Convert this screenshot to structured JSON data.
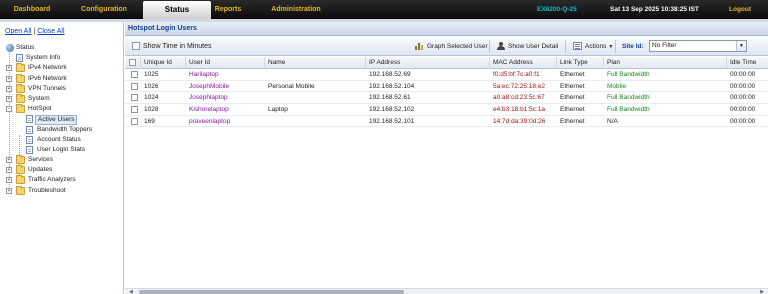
{
  "topnav": {
    "items": [
      {
        "label": "Dashboard"
      },
      {
        "label": "Configuration"
      },
      {
        "label": "Status"
      },
      {
        "label": "Reports"
      },
      {
        "label": "Administration"
      }
    ],
    "device": "EX6200-Q-25",
    "datetime": "Sat 13 Sep 2025 10:38:25 IST",
    "logout": "Logout"
  },
  "sidebar": {
    "open_all": "Open All",
    "separator": "|",
    "close_all": "Close All",
    "tree": [
      {
        "label": "Status"
      },
      {
        "label": "System Info"
      },
      {
        "label": "IPv4 Network"
      },
      {
        "label": "IPv6 Network"
      },
      {
        "label": "VPN Tunnels"
      },
      {
        "label": "System"
      },
      {
        "label": "HotSpot"
      },
      {
        "label": "Active Users"
      },
      {
        "label": "Bandwidth Toppers"
      },
      {
        "label": "Account Status"
      },
      {
        "label": "User Login Stats"
      },
      {
        "label": "Services"
      },
      {
        "label": "Updates"
      },
      {
        "label": "Traffic Analyzers"
      },
      {
        "label": "Troubleshoot"
      }
    ]
  },
  "main": {
    "title": "Hotspot Login Users",
    "toolbar": {
      "show_time_label": "Show Time in Minutes",
      "graph_label": "Graph Selected User",
      "detail_label": "Show User Detail",
      "actions_label": "Actions",
      "siteid_label": "Site Id:",
      "siteid_value": "No Filter"
    },
    "columns": [
      "Unique Id",
      "User Id",
      "Name",
      "IP Address",
      "MAC Address",
      "Link Type",
      "Plan",
      "Idle Time"
    ],
    "rows": [
      {
        "unique_id": "1025",
        "user_id": "Harilaptop",
        "name": "",
        "ip": "192.168.52.69",
        "mac": "f0:d5:bf:7c:a0:f1",
        "link": "Ethernet",
        "plan": "Full Bandwidth",
        "idle": "00:00:00"
      },
      {
        "unique_id": "1026",
        "user_id": "JosephMobile",
        "name": "Personal Mobile",
        "ip": "192.168.52.104",
        "mac": "5a:ec:72:25:18:e2",
        "link": "Ethernet",
        "plan": "Mobile",
        "idle": "00:00:00"
      },
      {
        "unique_id": "1024",
        "user_id": "Josephlaptop",
        "name": "",
        "ip": "192.168.52.61",
        "mac": "a0:a8:cd:23:5c:67",
        "link": "Ethernet",
        "plan": "Full Bandwidth",
        "idle": "00:00:00"
      },
      {
        "unique_id": "1028",
        "user_id": "Kishorelaptop",
        "name": "Laptop",
        "ip": "192.168.52.102",
        "mac": "e4:b3:18:b1:5c:1a",
        "link": "Ethernet",
        "plan": "Full Bandwidth",
        "idle": "00:00:00"
      },
      {
        "unique_id": "169",
        "user_id": "praveenlaptop",
        "name": "",
        "ip": "192.168.52.101",
        "mac": "14:7d:da:39:0d:26",
        "link": "Ethernet",
        "plan": "N/A",
        "idle": "00:00:00"
      }
    ]
  },
  "colors": {
    "nav_text": "#e7b62a",
    "device_text": "#19b8d0",
    "user_id_text": "#8a17a6",
    "mac_text": "#9b1111",
    "plan_text": "#128a1a",
    "title_text": "#15428b"
  }
}
